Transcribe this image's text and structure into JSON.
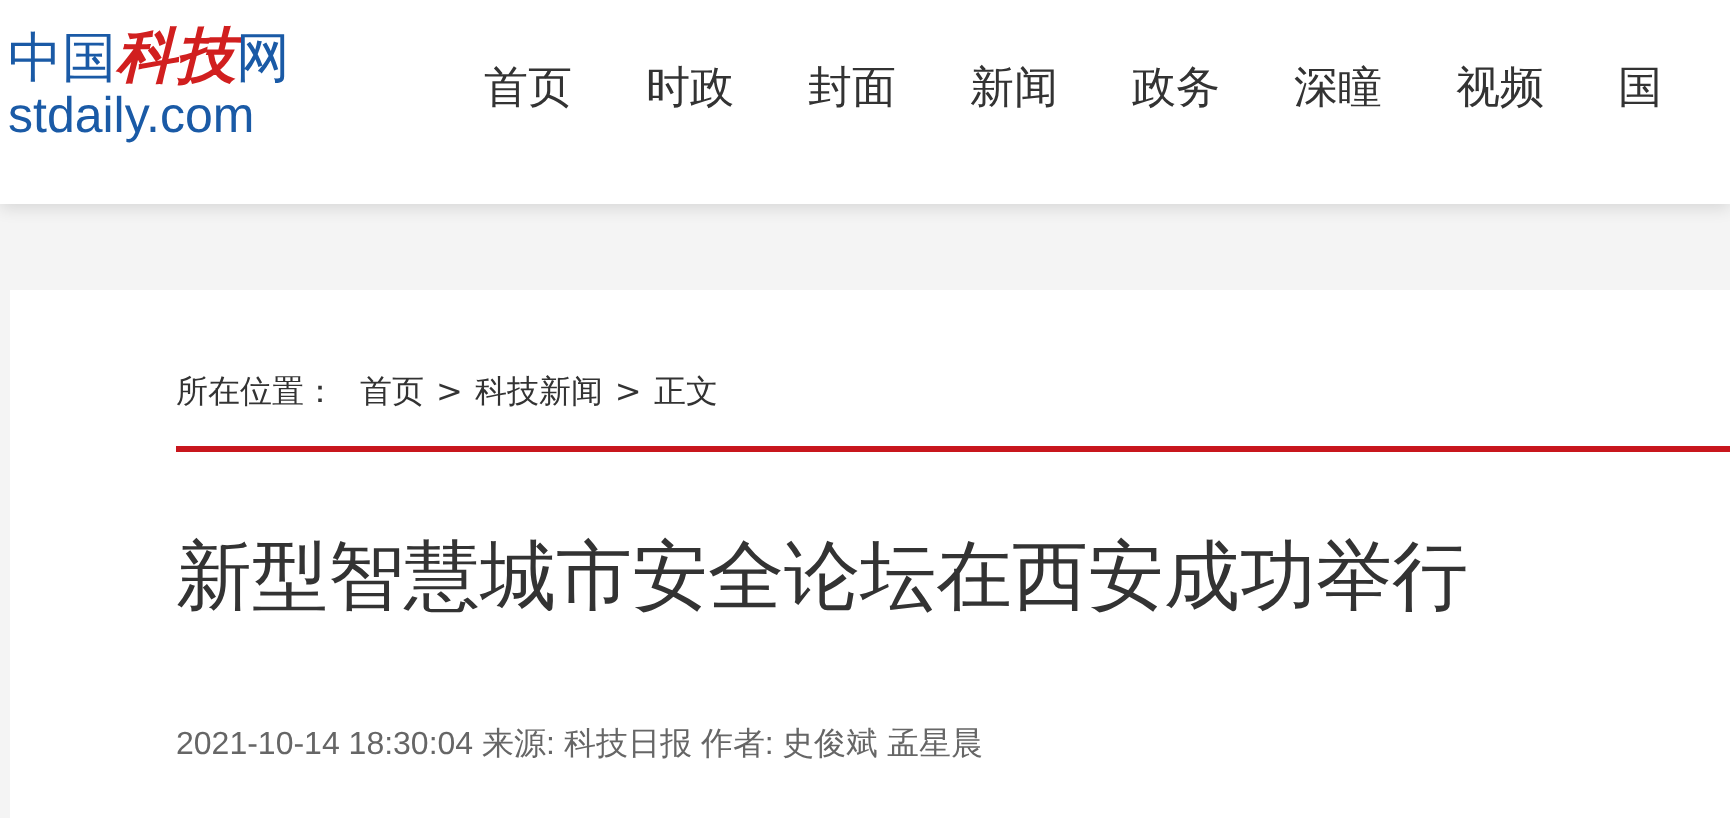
{
  "logo": {
    "name_parts": [
      {
        "text": "中国",
        "color": "#1a5aa6"
      },
      {
        "text": "科技",
        "color": "#d11f1f"
      },
      {
        "text": "网",
        "color": "#1a5aa6"
      }
    ],
    "domain": "stdaily.com"
  },
  "nav": [
    "首页",
    "时政",
    "封面",
    "新闻",
    "政务",
    "深瞳",
    "视频",
    "国"
  ],
  "breadcrumb": {
    "label": "所在位置：",
    "separator": ">",
    "links": [
      "首页",
      "科技新闻",
      "正文"
    ]
  },
  "article": {
    "title": "新型智慧城市安全论坛在西安成功举行",
    "meta": "2021-10-14 18:30:04 来源: 科技日报 作者: 史俊斌 孟星晨"
  }
}
